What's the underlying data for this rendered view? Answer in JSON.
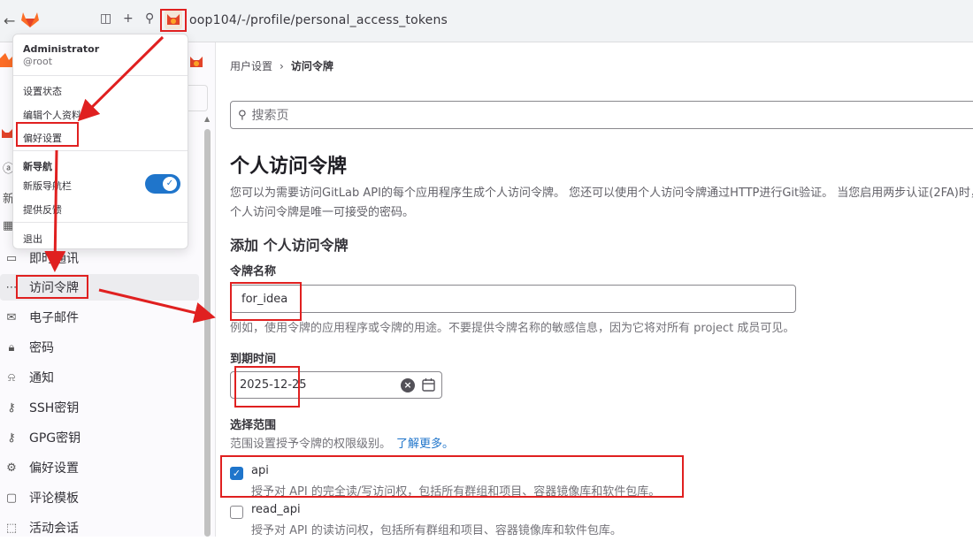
{
  "browser": {
    "url": "oop104/-/profile/personal_access_tokens"
  },
  "sidebar": {
    "items": [
      {
        "icon": "chat-bubble-icon",
        "label": "即时通讯"
      },
      {
        "icon": "ellipsis-token-icon",
        "label": "访问令牌"
      },
      {
        "icon": "mail-icon",
        "label": "电子邮件"
      },
      {
        "icon": "lock-icon",
        "label": "密码"
      },
      {
        "icon": "bell-icon",
        "label": "通知"
      },
      {
        "icon": "key-icon",
        "label": "SSH密钥"
      },
      {
        "icon": "key-icon",
        "label": "GPG密钥"
      },
      {
        "icon": "preferences-icon",
        "label": "偏好设置"
      },
      {
        "icon": "comment-template-icon",
        "label": "评论模板"
      },
      {
        "icon": "sessions-icon",
        "label": "活动会话"
      }
    ]
  },
  "dropdown": {
    "name": "Administrator",
    "username": "@root",
    "set_status": "设置状态",
    "edit_profile": "编辑个人资料",
    "preferences": "偏好设置",
    "new_nav_header": "新导航",
    "new_nav_toggle": "新版导航栏",
    "feedback": "提供反馈",
    "sign_out": "退出"
  },
  "main": {
    "breadcrumb": [
      "用户设置",
      "访问令牌"
    ],
    "search_placeholder": "搜索页",
    "title": "个人访问令牌",
    "description": "您可以为需要访问GitLab API的每个应用程序生成个人访问令牌。 您还可以使用个人访问令牌通过HTTP进行Git验证。 当您启用两步认证(2FA)时，个人访问令牌是唯一可接受的密码。",
    "add_title": "添加 个人访问令牌",
    "name_label": "令牌名称",
    "name_value": "for_idea",
    "name_help": "例如，使用令牌的应用程序或令牌的用途。不要提供令牌名称的敏感信息，因为它将对所有 project 成员可见。",
    "expiry_label": "到期时间",
    "expiry_value": "2025-12-25",
    "scopes_label": "选择范围",
    "scopes_help": "范围设置授予令牌的权限级别。",
    "learn_more": "了解更多。",
    "scopes": [
      {
        "name": "api",
        "checked": true,
        "desc": "授予对 API 的完全读/写访问权，包括所有群组和项目、容器镜像库和软件包库。"
      },
      {
        "name": "read_api",
        "checked": false,
        "desc": "授予对 API 的读访问权，包括所有群组和项目、容器镜像库和软件包库。"
      }
    ]
  },
  "colors": {
    "accent": "#1f75cb",
    "annotation_red": "#e02020",
    "gitlab_orange": "#fc6d26"
  }
}
